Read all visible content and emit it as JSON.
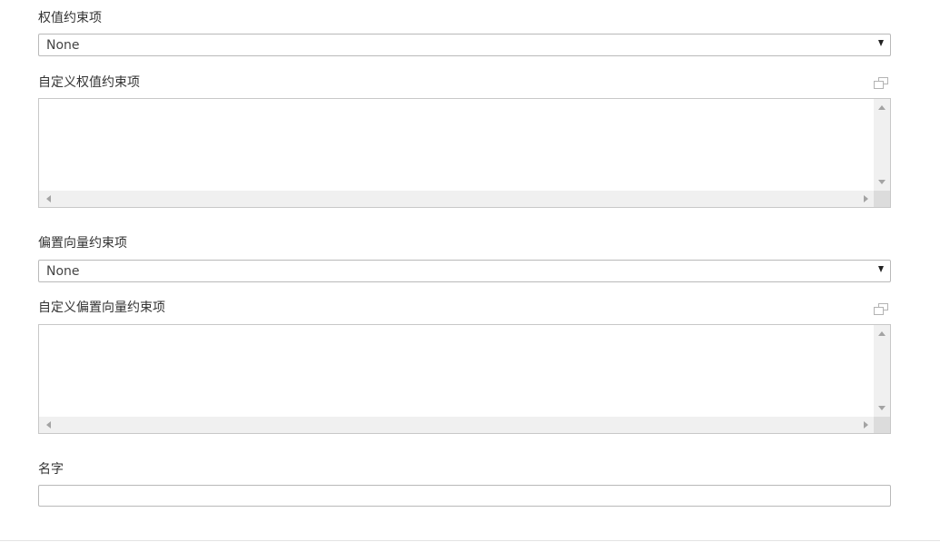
{
  "fields": {
    "weight_constraint": {
      "label": "权值约束项",
      "selected": "None"
    },
    "custom_weight_constraint": {
      "label": "自定义权值约束项",
      "value": ""
    },
    "bias_constraint": {
      "label": "偏置向量约束项",
      "selected": "None"
    },
    "custom_bias_constraint": {
      "label": "自定义偏置向量约束项",
      "value": ""
    },
    "name": {
      "label": "名字",
      "value": ""
    }
  },
  "icons": {
    "popout": "popout-window-icon",
    "dropdown": "caret-down-icon",
    "scroll_up": "scroll-up-arrow-icon",
    "scroll_down": "scroll-down-arrow-icon",
    "scroll_left": "scroll-left-arrow-icon",
    "scroll_right": "scroll-right-arrow-icon"
  },
  "colors": {
    "border": "#b9b9b9",
    "scrollbar_track": "#f0f0f0",
    "text": "#333333"
  }
}
